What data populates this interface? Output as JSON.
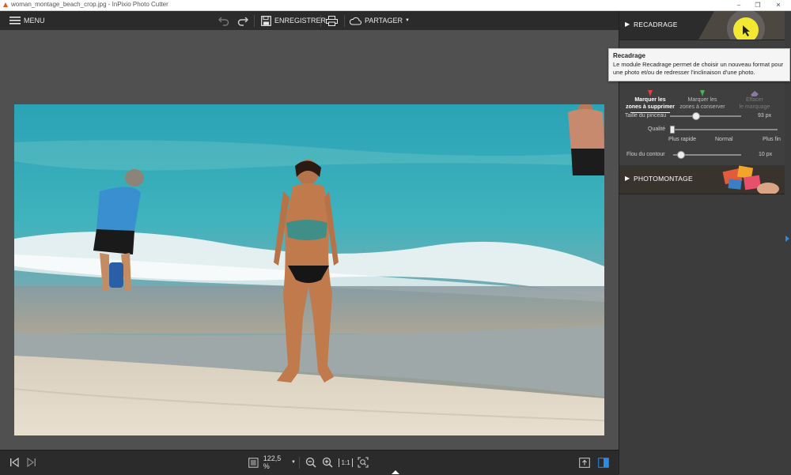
{
  "window": {
    "title": "woman_montage_beach_crop.jpg - InPixio Photo Cutter",
    "controls": [
      "–",
      "❐",
      "✕"
    ]
  },
  "toolbar": {
    "menu_label": "MENU",
    "save_label": "ENREGISTRER",
    "share_label": "PARTAGER"
  },
  "panel": {
    "recadrage_label": "RECADRAGE",
    "photomontage_label": "PHOTOMONTAGE",
    "tooltip": {
      "title": "Recadrage",
      "body": "Le module Recadrage permet de choisir un nouveau format pour une photo et/ou de redresser l'inclinaison d'une photo."
    },
    "tools": [
      {
        "line1": "Marquer les",
        "line2": "zones à supprimer",
        "color": "#e04040"
      },
      {
        "line1": "Marquer les",
        "line2": "zones à conserver",
        "color": "#4caf50"
      },
      {
        "line1": "Effacer",
        "line2": "le marquage",
        "color": "#9e9e9e"
      }
    ],
    "brush_size": {
      "label": "Taille du pinceau",
      "value": "93 px",
      "level": 0.35
    },
    "quality": {
      "label": "Qualité",
      "options": [
        "Plus rapide",
        "Normal",
        "Plus fin"
      ],
      "level": 0.0
    },
    "edge_blur": {
      "label": "Flou du contour",
      "value": "10 px",
      "level": 0.1
    }
  },
  "bottom": {
    "zoom_label": "122,5 %",
    "fit_label": "1:1"
  },
  "colors": {
    "accent": "#2b8ce6",
    "toolbar_bg": "#2b2b2b",
    "workspace_bg": "#505050"
  }
}
